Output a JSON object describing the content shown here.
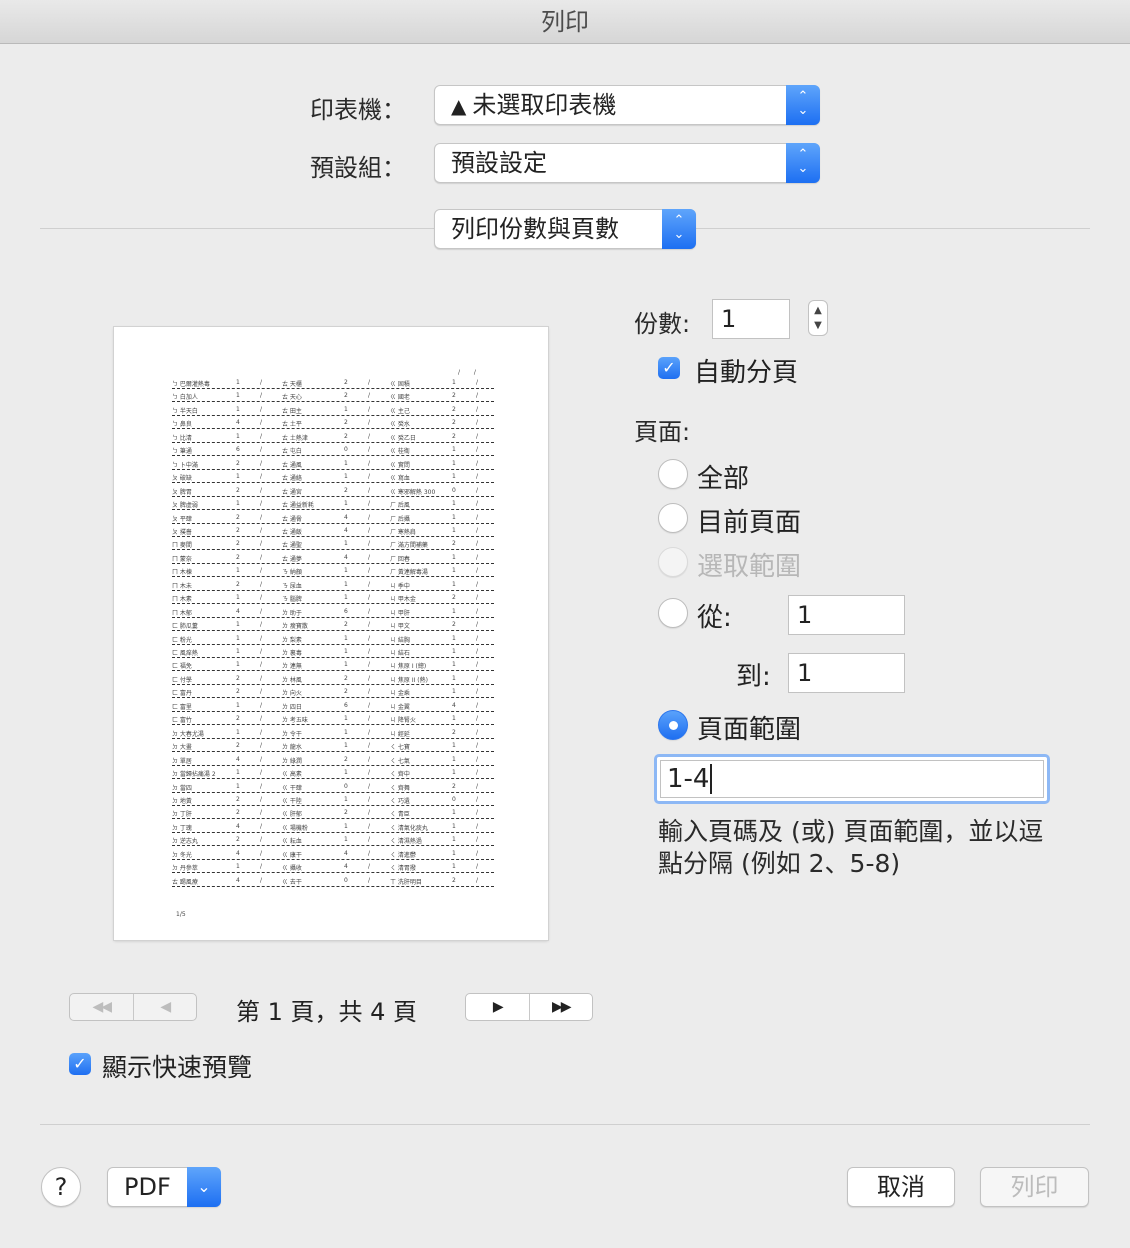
{
  "window": {
    "title": "列印"
  },
  "printer": {
    "label": "印表機：",
    "value": "未選取印表機",
    "warning_icon": "warning-triangle-icon"
  },
  "presets": {
    "label": "預設組：",
    "value": "預設設定"
  },
  "section": {
    "value": "列印份數與頁數"
  },
  "copies": {
    "label": "份數:",
    "value": "1"
  },
  "collate": {
    "label": "自動分頁",
    "checked": true
  },
  "pages": {
    "label": "頁面:",
    "options": [
      {
        "label": "全部",
        "selected": false,
        "enabled": true
      },
      {
        "label": "目前頁面",
        "selected": false,
        "enabled": true
      },
      {
        "label": "選取範圍",
        "selected": false,
        "enabled": false
      },
      {
        "label": "從:",
        "selected": false,
        "enabled": true
      },
      {
        "label": "頁面範圍",
        "selected": true,
        "enabled": true
      }
    ],
    "from_value": "1",
    "to_label": "到:",
    "to_value": "1",
    "range_value": "1-4",
    "hint": "輸入頁碼及 (或) 頁面範圍，並以逗點分隔 (例如 2、5-8)"
  },
  "preview": {
    "footer": "1/5",
    "header_marks": "/ /",
    "rows": [
      [
        "ㄅ 巴爾灌熱毒",
        "1",
        "/",
        "ㄊ 天櫃",
        "2",
        "/",
        "ㄍ 固積",
        "1",
        "/"
      ],
      [
        "ㄅ 白加人",
        "1",
        "/",
        "ㄊ 天心",
        "2",
        "/",
        "ㄍ 國老",
        "2",
        "/"
      ],
      [
        "ㄅ 半天白",
        "1",
        "/",
        "ㄊ 田主",
        "1",
        "/",
        "ㄍ 主己",
        "2",
        "/"
      ],
      [
        "ㄅ 鼻良",
        "4",
        "/",
        "ㄊ 土平",
        "2",
        "/",
        "ㄍ 癸水",
        "2",
        "/"
      ],
      [
        "ㄅ 比清",
        "1",
        "/",
        "ㄊ 土熱津",
        "2",
        "/",
        "ㄍ 癸乙日",
        "2",
        "/"
      ],
      [
        "ㄅ 筆通",
        "6",
        "/",
        "ㄊ 屯白",
        "0",
        "/",
        "ㄍ 桂衛",
        "1",
        "/"
      ],
      [
        "ㄅ 卜中滿",
        "2",
        "/",
        "ㄊ 通風",
        "1",
        "/",
        "ㄍ 實問",
        "1",
        "/"
      ],
      [
        "ㄆ 破缺",
        "1",
        "/",
        "ㄊ 通絡",
        "1",
        "/",
        "ㄍ 寫血",
        "1",
        "/"
      ],
      [
        "ㄆ 脾胃",
        "2",
        "/",
        "ㄊ 通宮",
        "2",
        "/",
        "ㄍ 寒邪解熱 300",
        "0",
        "/"
      ],
      [
        "ㄆ 脾虛弱",
        "1",
        "/",
        "ㄊ 通益新耗",
        "1",
        "/",
        "ㄏ 后風",
        "1",
        "/"
      ],
      [
        "ㄆ 平肆",
        "2",
        "/",
        "ㄊ 通脅",
        "4",
        "/",
        "ㄏ 后攝",
        "1",
        "/"
      ],
      [
        "ㄆ 撲嗇",
        "2",
        "/",
        "ㄊ 通飯",
        "4",
        "/",
        "ㄏ 寒熱肩",
        "1",
        "/"
      ],
      [
        "ㄇ 麥間",
        "2",
        "/",
        "ㄊ 通聖",
        "1",
        "/",
        "ㄏ 滿方間補藥",
        "2",
        "/"
      ],
      [
        "ㄇ 蒙奈",
        "2",
        "/",
        "ㄊ 通夢",
        "4",
        "/",
        "ㄏ 回春",
        "1",
        "/"
      ],
      [
        "ㄇ 木棟",
        "1",
        "/",
        "ㄋ 納顏",
        "1",
        "/",
        "ㄏ 黃連解毒湯",
        "1",
        "/"
      ],
      [
        "ㄇ 木未",
        "2",
        "/",
        "ㄋ 尿血",
        "1",
        "/",
        "ㄐ 季中",
        "1",
        "/"
      ],
      [
        "ㄇ 木素",
        "1",
        "/",
        "ㄋ 腦脾",
        "1",
        "/",
        "ㄐ 甲木金",
        "2",
        "/"
      ],
      [
        "ㄇ 木郁",
        "4",
        "/",
        "ㄌ 助于",
        "6",
        "/",
        "ㄐ 甲肝",
        "1",
        "/"
      ],
      [
        "ㄈ 肺瓜蔞",
        "1",
        "/",
        "ㄌ 瘦寶散",
        "2",
        "/",
        "ㄐ 甲文",
        "2",
        "/"
      ],
      [
        "ㄈ 粉光",
        "1",
        "/",
        "ㄌ 梨素",
        "1",
        "/",
        "ㄐ 結胸",
        "1",
        "/"
      ],
      [
        "ㄈ 風痒熱",
        "1",
        "/",
        "ㄌ 裏毒",
        "1",
        "/",
        "ㄐ 結石",
        "1",
        "/"
      ],
      [
        "ㄈ 福免",
        "1",
        "/",
        "ㄌ 連無",
        "1",
        "/",
        "ㄐ 焦原 I (總)",
        "1",
        "/"
      ],
      [
        "ㄈ 付學",
        "2",
        "/",
        "ㄌ 林風",
        "2",
        "/",
        "ㄐ 焦原 II (熱)",
        "1",
        "/"
      ],
      [
        "ㄈ 富丹",
        "2",
        "/",
        "ㄌ 向火",
        "2",
        "/",
        "ㄐ 金乘",
        "1",
        "/"
      ],
      [
        "ㄈ 富里",
        "1",
        "/",
        "ㄌ 四日",
        "6",
        "/",
        "ㄐ 金翼",
        "4",
        "/"
      ],
      [
        "ㄈ 富竹",
        "2",
        "/",
        "ㄌ 考五味",
        "1",
        "/",
        "ㄐ 降腎火",
        "1",
        "/"
      ],
      [
        "ㄉ 大春尤湯",
        "1",
        "/",
        "ㄌ 令干",
        "1",
        "/",
        "ㄐ 經延",
        "2",
        "/"
      ],
      [
        "ㄉ 大畫",
        "2",
        "/",
        "ㄌ 龍水",
        "1",
        "/",
        "ㄑ 七寶",
        "1",
        "/"
      ],
      [
        "ㄉ 單居",
        "4",
        "/",
        "ㄌ 綠潤",
        "2",
        "/",
        "ㄑ 七氣",
        "1",
        "/"
      ],
      [
        "ㄉ 當歸拈痛湯 2",
        "1",
        "/",
        "ㄍ 高素",
        "1",
        "/",
        "ㄑ 齊中",
        "1",
        "/"
      ],
      [
        "ㄉ 當四",
        "1",
        "/",
        "ㄍ 干肆",
        "0",
        "/",
        "ㄑ 齊舞",
        "2",
        "/"
      ],
      [
        "ㄉ 地黃",
        "2",
        "/",
        "ㄍ 干陸",
        "1",
        "/",
        "ㄑ 巧遺",
        "0",
        "/"
      ],
      [
        "ㄉ 丁肝",
        "2",
        "/",
        "ㄍ 肝郁",
        "2",
        "/",
        "ㄑ 青臣",
        "1",
        "/"
      ],
      [
        "ㄉ 丁瑰",
        "4",
        "/",
        "ㄍ 場機粉",
        "1",
        "/",
        "ㄑ 清氣化痰丸",
        "1",
        "/"
      ],
      [
        "ㄉ 逆志丸",
        "2",
        "/",
        "ㄍ 耘血",
        "1",
        "/",
        "ㄑ 清濕熱過",
        "1",
        "/"
      ],
      [
        "ㄉ 冬光",
        "4",
        "/",
        "ㄍ 康干",
        "4",
        "/",
        "ㄑ 清進鬱",
        "1",
        "/"
      ],
      [
        "ㄉ 丹參萃",
        "1",
        "/",
        "ㄍ 攝收",
        "4",
        "/",
        "ㄑ 清胃撥",
        "1",
        "/"
      ],
      [
        "ㄊ 踢風療",
        "4",
        "/",
        "ㄍ 去干",
        "0",
        "/",
        "ㄒ 洗肝明目",
        "2",
        "/"
      ]
    ]
  },
  "nav": {
    "first": "◀◀",
    "prev": "◀",
    "page_status": "第 1 頁，共 4 頁",
    "next": "▶",
    "last": "▶▶"
  },
  "quick_preview": {
    "label": "顯示快速預覽",
    "checked": true
  },
  "footer": {
    "help": "?",
    "pdf": "PDF",
    "cancel": "取消",
    "print": "列印"
  }
}
